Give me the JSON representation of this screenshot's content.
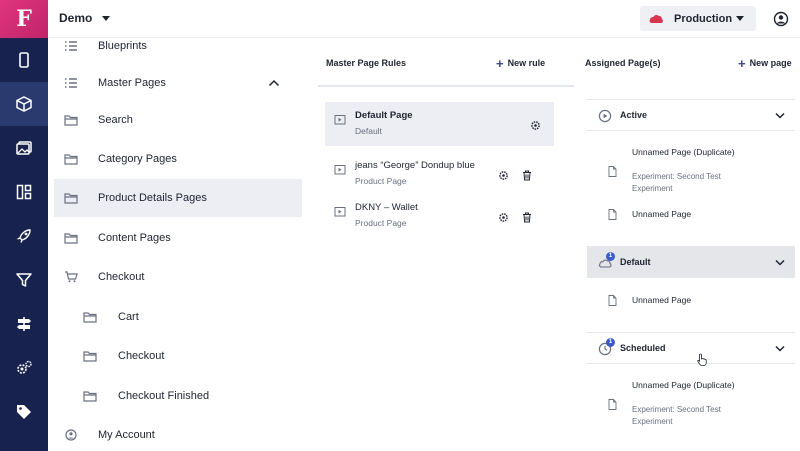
{
  "app": {
    "logo_letter": "F"
  },
  "rail": {
    "items": [
      {
        "name": "mobile-icon",
        "active": false
      },
      {
        "name": "cube-icon",
        "active": true
      },
      {
        "name": "media-icon",
        "active": false
      },
      {
        "name": "layout-icon",
        "active": false
      },
      {
        "name": "rocket-icon",
        "active": false
      },
      {
        "name": "filter-icon",
        "active": false
      },
      {
        "name": "signpost-icon",
        "active": false
      },
      {
        "name": "settings-icon",
        "active": false
      },
      {
        "name": "tag-icon",
        "active": false
      }
    ]
  },
  "topbar": {
    "workspace": "Demo",
    "environment": "Production",
    "environment_color": "#d7364f"
  },
  "tree": {
    "items": [
      {
        "label": "Blueprints",
        "icon": "list-icon"
      },
      {
        "label": "Master Pages",
        "icon": "list-icon",
        "expanded": true
      },
      {
        "label": "Search",
        "icon": "folder-icon"
      },
      {
        "label": "Category Pages",
        "icon": "folder-icon"
      },
      {
        "label": "Product Details Pages",
        "icon": "folder-icon",
        "selected": true
      },
      {
        "label": "Content Pages",
        "icon": "folder-icon"
      },
      {
        "label": "Checkout",
        "icon": "cart-icon"
      },
      {
        "label": "Cart",
        "icon": "folder-icon"
      },
      {
        "label": "Checkout",
        "icon": "folder-icon"
      },
      {
        "label": "Checkout Finished",
        "icon": "folder-icon"
      },
      {
        "label": "My Account",
        "icon": "user-circle-icon"
      }
    ]
  },
  "rules_panel": {
    "title": "Master Page Rules",
    "action": "New rule",
    "rules": [
      {
        "name": "Default Page",
        "type": "Default",
        "selected": true
      },
      {
        "name": "jeans “George” Dondup blue",
        "type": "Product Page"
      },
      {
        "name": "DKNY – Wallet",
        "type": "Product Page"
      }
    ]
  },
  "assigned_panel": {
    "title": "Assigned Page(s)",
    "action": "New page",
    "sections": [
      {
        "label": "Active",
        "pages": [
          {
            "name": "Unnamed Page (Duplicate)",
            "sub": "Experiment: Second Test Experiment"
          },
          {
            "name": "Unnamed Page",
            "sub": ""
          }
        ]
      },
      {
        "label": "Default",
        "badge": "1",
        "pages": [
          {
            "name": "Unnamed Page",
            "sub": ""
          }
        ]
      },
      {
        "label": "Scheduled",
        "badge": "1",
        "pages": [
          {
            "name": "Unnamed Page (Duplicate)",
            "sub": "Experiment: Second Test Experiment"
          }
        ]
      }
    ]
  }
}
